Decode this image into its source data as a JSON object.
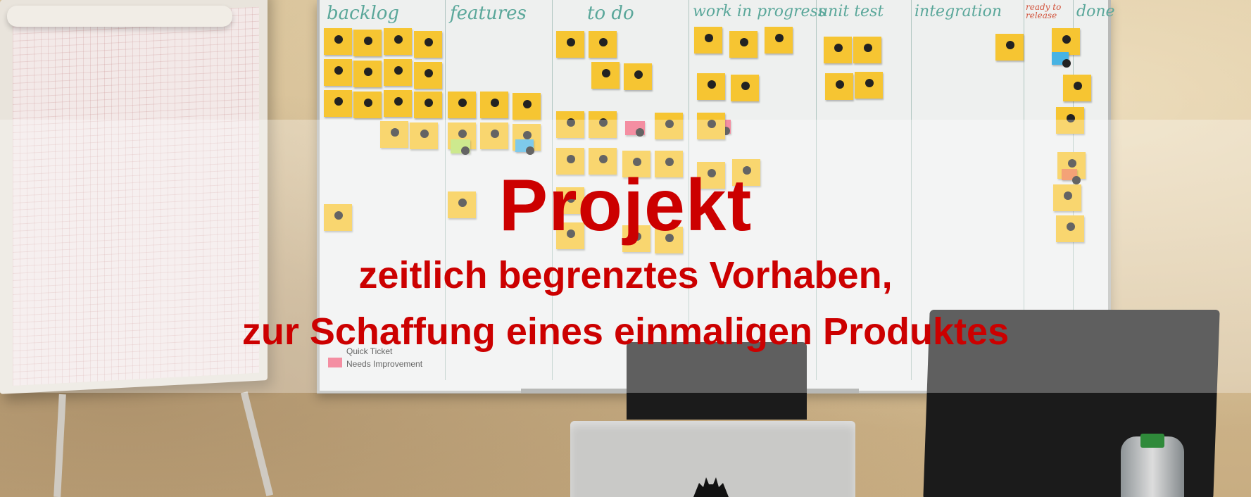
{
  "overlay": {
    "title": "Projekt",
    "line1": "zeitlich begrenztes Vorhaben,",
    "line2": "zur Schaffung eines einmaligen Produktes",
    "text_color": "#cc0000"
  },
  "kanban_board": {
    "columns": [
      "backlog",
      "features",
      "to do",
      "work in progress",
      "unit test",
      "integration",
      "ready to release",
      "done"
    ]
  },
  "legend": {
    "items": [
      "Quick Ticket",
      "Needs Improvement"
    ]
  },
  "colors": {
    "sticky_note": "#f6c532",
    "column_heading": "#5aa79a"
  }
}
